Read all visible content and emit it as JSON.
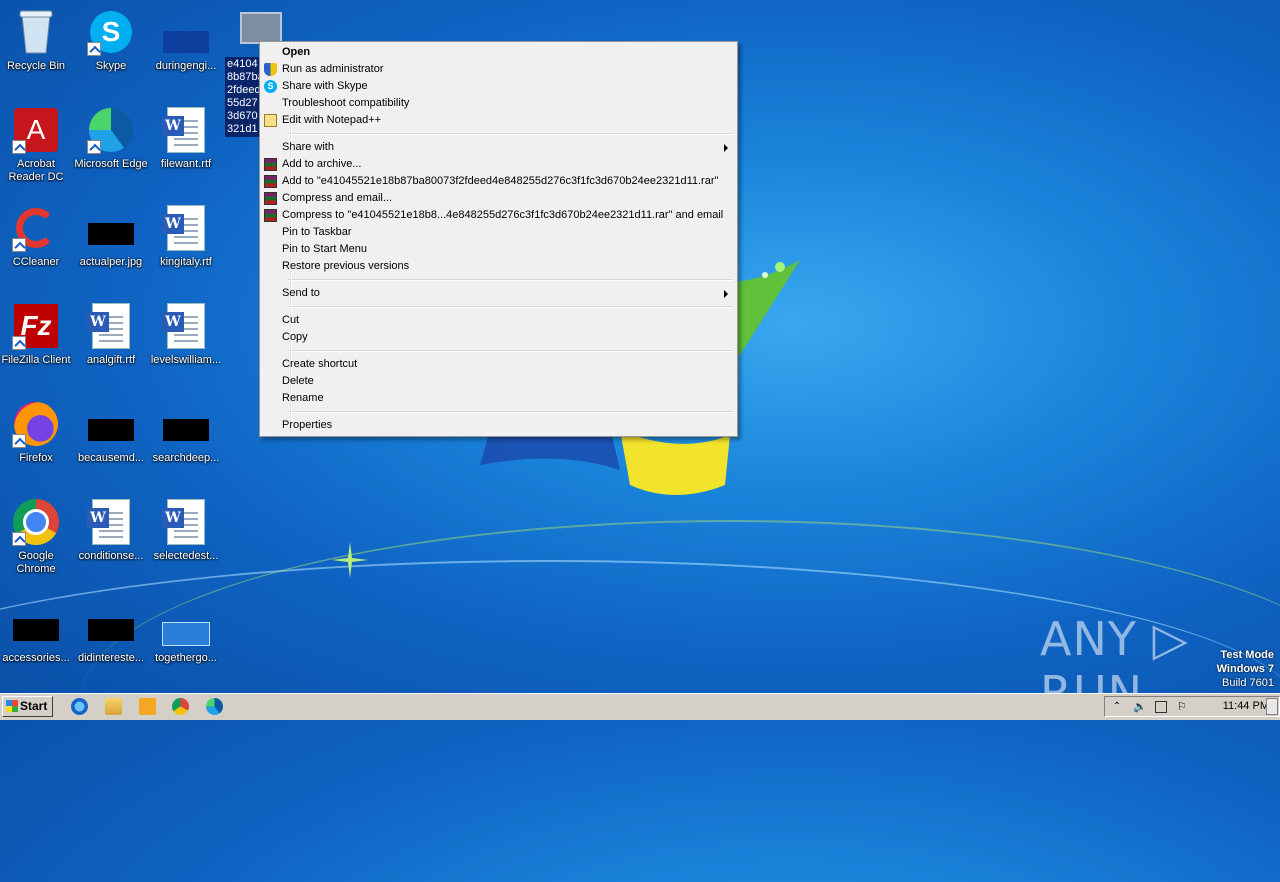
{
  "desktop": {
    "icons": [
      {
        "label": "Recycle Bin",
        "icon": "recycle-bin-icon"
      },
      {
        "label": "Skype",
        "icon": "skype-icon"
      },
      {
        "label": "duringengi...",
        "icon": "file-thumbnail-icon"
      },
      {
        "label": "Acrobat Reader DC",
        "icon": "acrobat-icon"
      },
      {
        "label": "Microsoft Edge",
        "icon": "edge-icon"
      },
      {
        "label": "filewant.rtf",
        "icon": "word-doc-icon"
      },
      {
        "label": "CCleaner",
        "icon": "ccleaner-icon"
      },
      {
        "label": "actualper.jpg",
        "icon": "image-thumbnail-icon"
      },
      {
        "label": "kingitaly.rtf",
        "icon": "word-doc-icon"
      },
      {
        "label": "FileZilla Client",
        "icon": "filezilla-icon"
      },
      {
        "label": "analgift.rtf",
        "icon": "word-doc-icon"
      },
      {
        "label": "levelswilliam...",
        "icon": "word-doc-icon"
      },
      {
        "label": "Firefox",
        "icon": "firefox-icon"
      },
      {
        "label": "becausemd...",
        "icon": "image-thumbnail-icon"
      },
      {
        "label": "searchdeep...",
        "icon": "image-thumbnail-icon"
      },
      {
        "label": "Google Chrome",
        "icon": "chrome-icon"
      },
      {
        "label": "conditionse...",
        "icon": "word-doc-icon"
      },
      {
        "label": "selectedest...",
        "icon": "word-doc-icon"
      },
      {
        "label": "accessories...",
        "icon": "image-thumbnail-icon"
      },
      {
        "label": "didintereste...",
        "icon": "image-thumbnail-icon"
      },
      {
        "label": "togethergo...",
        "icon": "file-thumbnail-icon"
      }
    ],
    "selected_file_label_lines": [
      "e4104",
      "8b87ba",
      "2fdeed",
      "55d27",
      "3d670",
      "321d1"
    ]
  },
  "context_menu": {
    "items": [
      {
        "label": "Open",
        "bold": true
      },
      {
        "label": "Run as administrator",
        "icon": "uac-shield-icon"
      },
      {
        "label": "Share with Skype",
        "icon": "skype-icon"
      },
      {
        "label": "Troubleshoot compatibility"
      },
      {
        "label": "Edit with Notepad++",
        "icon": "notepadpp-icon"
      },
      {
        "label": "Share with",
        "submenu": true
      },
      {
        "label": "Add to archive...",
        "icon": "winrar-icon"
      },
      {
        "label": "Add to \"e41045521e18b87ba80073f2fdeed4e848255d276c3f1fc3d670b24ee2321d11.rar\"",
        "icon": "winrar-icon"
      },
      {
        "label": "Compress and email...",
        "icon": "winrar-icon"
      },
      {
        "label": "Compress to \"e41045521e18b8...4e848255d276c3f1fc3d670b24ee2321d11.rar\" and email",
        "icon": "winrar-icon"
      },
      {
        "label": "Pin to Taskbar"
      },
      {
        "label": "Pin to Start Menu"
      },
      {
        "label": "Restore previous versions"
      },
      {
        "label": "Send to",
        "submenu": true
      },
      {
        "label": "Cut"
      },
      {
        "label": "Copy"
      },
      {
        "label": "Create shortcut"
      },
      {
        "label": "Delete"
      },
      {
        "label": "Rename"
      },
      {
        "label": "Properties"
      }
    ]
  },
  "watermark": {
    "brand": "ANY ▷ RUN",
    "test_mode": "Test Mode",
    "os": "Windows 7",
    "build": "Build 7601"
  },
  "taskbar": {
    "start_label": "Start",
    "pinned": [
      "ie-icon",
      "explorer-icon",
      "media-player-icon",
      "chrome-icon",
      "edge-icon"
    ],
    "clock": "11:44 PM"
  },
  "colors": {
    "desktop_blue": "#0f63c2",
    "selection": "#0a246a",
    "menu_bg": "#f0f0f0",
    "taskbar": "#d4d0c8"
  }
}
